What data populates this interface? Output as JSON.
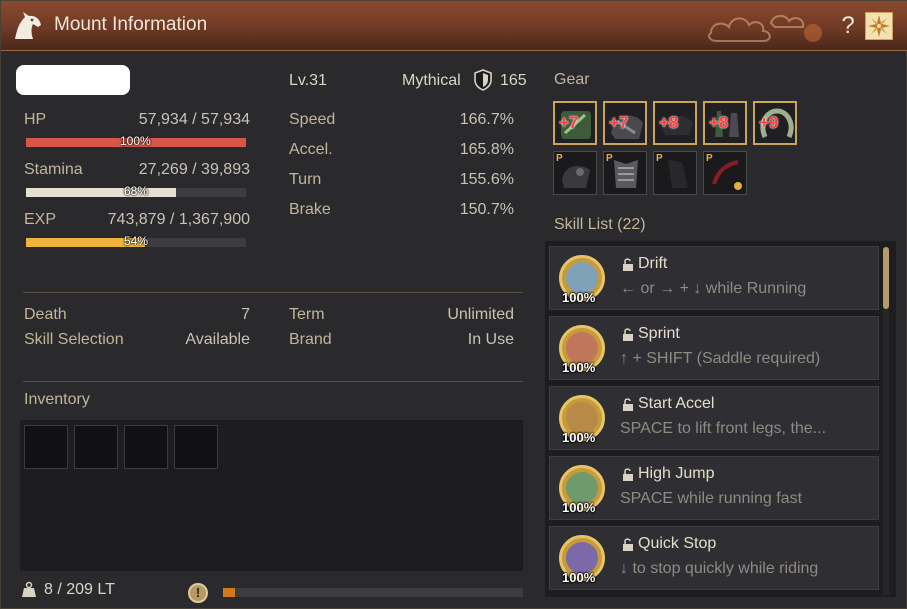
{
  "window": {
    "title": "Mount Information"
  },
  "mount": {
    "level": "Lv.31",
    "grade": "Mythical",
    "armor": "165"
  },
  "vitals": [
    {
      "label": "HP",
      "value": "57,934 / 57,934",
      "percent_label": "100%",
      "fill": 1.0,
      "color": "#d6574a"
    },
    {
      "label": "Stamina",
      "value": "27,269 / 39,893",
      "percent_label": "68%",
      "fill": 0.68,
      "color": "#e6e0d2"
    },
    {
      "label": "EXP",
      "value": "743,879 / 1,367,900",
      "percent_label": "54%",
      "fill": 0.54,
      "color": "#f0b43c"
    }
  ],
  "stats": [
    {
      "label": "Speed",
      "value": "166.7%"
    },
    {
      "label": "Accel.",
      "value": "165.8%"
    },
    {
      "label": "Turn",
      "value": "155.6%"
    },
    {
      "label": "Brake",
      "value": "150.7%"
    }
  ],
  "info": {
    "death_label": "Death",
    "death_value": "7",
    "skill_selection_label": "Skill Selection",
    "skill_selection_value": "Available",
    "term_label": "Term",
    "term_value": "Unlimited",
    "brand_label": "Brand",
    "brand_value": "In Use"
  },
  "inventory": {
    "label": "Inventory",
    "weight": "8 / 209 LT",
    "weight_fill": 0.04
  },
  "gear": {
    "label": "Gear",
    "top_row": [
      {
        "enhancement": "+7",
        "icon": "horse-headgear-icon"
      },
      {
        "enhancement": "+7",
        "icon": "horse-armor-icon"
      },
      {
        "enhancement": "+8",
        "icon": "saddle-icon"
      },
      {
        "enhancement": "+8",
        "icon": "stirrups-icon"
      },
      {
        "enhancement": "+9",
        "icon": "horseshoe-icon"
      }
    ],
    "bottom_row": [
      {
        "badge": "P",
        "icon": "outfit-headgear-icon"
      },
      {
        "badge": "P",
        "icon": "outfit-armor-icon"
      },
      {
        "badge": "P",
        "icon": "outfit-saddle-icon"
      },
      {
        "badge": "P",
        "icon": "outfit-stirrups-icon"
      }
    ]
  },
  "skills": {
    "label": "Skill List (22)",
    "items": [
      {
        "name": "Drift",
        "desc": "← or → + ↓ while Running",
        "pct": "100%",
        "color": "#7fa2b8"
      },
      {
        "name": "Sprint",
        "desc": "↑ + SHIFT (Saddle required)",
        "pct": "100%",
        "color": "#c0765a"
      },
      {
        "name": "Start Accel",
        "desc": "SPACE to lift front legs, the...",
        "pct": "100%",
        "color": "#b88a4a"
      },
      {
        "name": "High Jump",
        "desc": "SPACE while running fast",
        "pct": "100%",
        "color": "#6f9a6c"
      },
      {
        "name": "Quick Stop",
        "desc": "↓ to stop quickly while riding",
        "pct": "100%",
        "color": "#7c6aa8"
      }
    ]
  }
}
